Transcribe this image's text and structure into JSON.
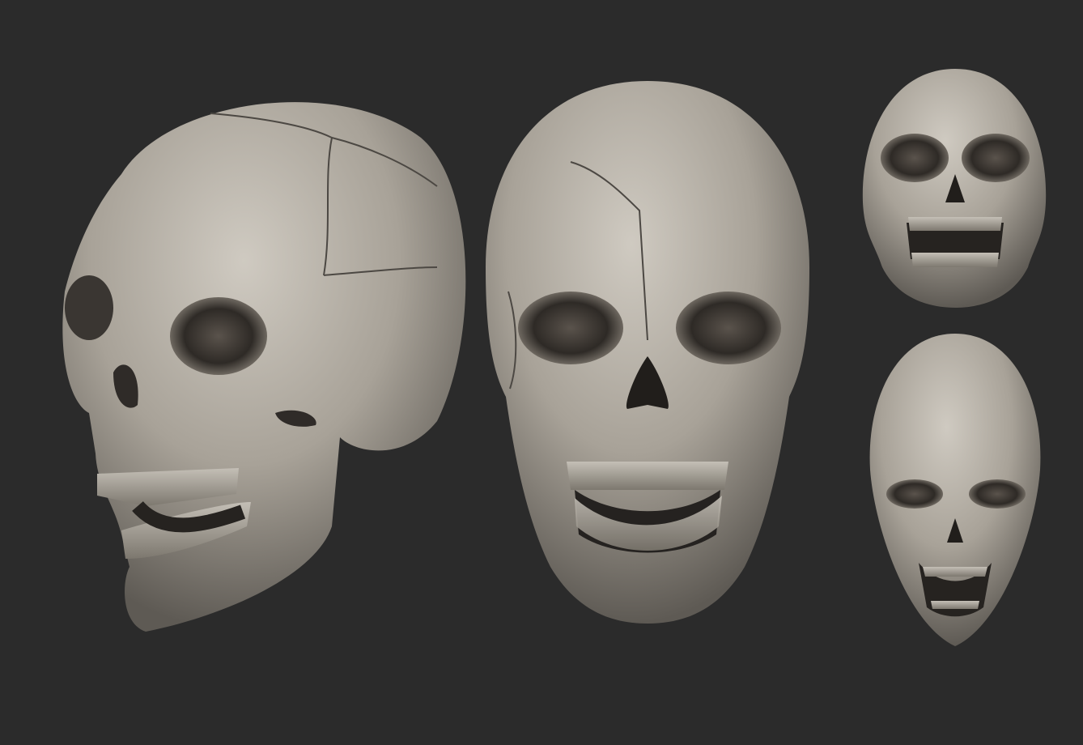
{
  "scene": {
    "background_color": "#2b2b2b",
    "bone_color": "#b8b2a8",
    "shadow_color": "#2a2724",
    "tooth_color": "#a9a49c",
    "skulls": [
      {
        "view": "three-quarter"
      },
      {
        "view": "front"
      },
      {
        "view": "front-high"
      },
      {
        "view": "front-low"
      }
    ]
  }
}
